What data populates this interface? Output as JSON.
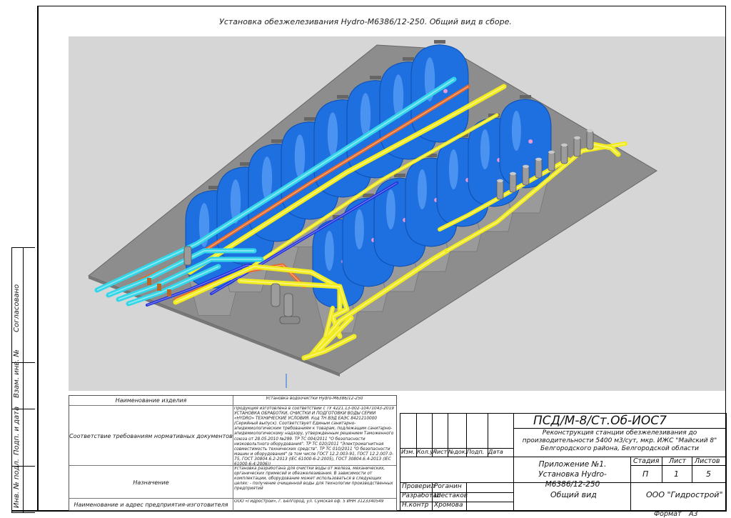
{
  "title": "Установка обезжелезивания Hydro-M6386/12-250. Общий вид в сборе.",
  "side_labels": {
    "agreed": "Согласовано",
    "replaced_inv": "Взам. инв. №",
    "sign_date": "Подп. и дата",
    "inv_orig": "Инв. № подл."
  },
  "doc_table": {
    "rows": [
      {
        "label": "Наименование изделия",
        "value": "Установка водоочистки Hydro-M6386/12-250"
      },
      {
        "label": "Соответствие требованиям нормативных документов",
        "value": "Продукция изготовлена в соответствии с ТУ 4221.13-002-10471043-2019 УСТАНОВКА ОБРАБОТКИ, ОЧИСТКИ И ПОДГОТОВКИ ВОДЫ СЕРИИ «HYDRO» ТЕХНИЧЕСКИЕ УСЛОВИЯ. Код ТН ВЭД ЕАЭС 8421210000 (Серийный выпуск). Соответствует Единым санитарно-эпидемиологическим требованиям к товарам, подлежащим санитарно-эпидемиологическому надзору, утвержденным решением Таможенного союза от 28.05.2010 №299. ТР ТС 004/2011 \"О безопасности низковольтного оборудования\". ТР ТС 020/2011 \"Электромагнитная совместимость технических средств\". ТР ТС 010/2011 \"О безопасности машин и оборудования\" (в том числе ГОСТ 12.2.003-91, ГОСТ 12.2.007.0-75, ГОСТ 30804.6.2-2013 (IEC 61000-6-2:2005), ГОСТ 30804.6.4-2013 (IEC 61000-6-4:2006))"
      },
      {
        "label": "Назначение",
        "value": "Установка разработана для очистки воды от железа, механических, органических примесей и обезжелезивания. В зависимости от комплектации, оборудование может использоваться в следующих целях: - получение очищенной воды для технологии производственных предприятий"
      },
      {
        "label": "Наименование и адрес предприятия-изготовителя",
        "value": "ООО «Гидрострой», г. Белгород, ул. Сумская оф. 5 ИНН 3123340549"
      }
    ]
  },
  "stamp": {
    "code": "ПСД/М-8/Ст.Об-ИОС7",
    "project": "Реконструкция станции обезжелезивания до производительности 5400 м3/сут, мкр. ИЖС \"Майский 8\" Белгородского района, Белгородской области",
    "columns": [
      "Изм.",
      "Кол.уч",
      "Лист",
      "№док.",
      "Подп.",
      "Дата"
    ],
    "roles": [
      {
        "role": "Проверил",
        "name": "Роганин"
      },
      {
        "role": "Разработал",
        "name": "Шестаков"
      },
      {
        "role": "Н.контр",
        "name": "Хромова"
      }
    ],
    "doc_name": "Приложение №1. Установка Hydro-M6386/12-250",
    "sheet_name": "Общий вид",
    "stage_label": "Стадия",
    "sheet_label": "Лист",
    "sheets_label": "Листов",
    "stage": "П",
    "sheet": "1",
    "sheets": "5",
    "org": "ООО \"Гидрострой\""
  },
  "format_label": "Формат",
  "format_value": "А3",
  "colors": {
    "tank": "#1e6fe0",
    "tank_highlight": "#6fb0ff",
    "pipe_yellow": "#f2ec1c",
    "pipe_cyan": "#33d6e8",
    "pipe_orange": "#e86a2a",
    "pipe_blue": "#2230e0",
    "cone": "#9a9a9a",
    "platform": "#8d8d8d",
    "background": "#d6d6d6"
  }
}
